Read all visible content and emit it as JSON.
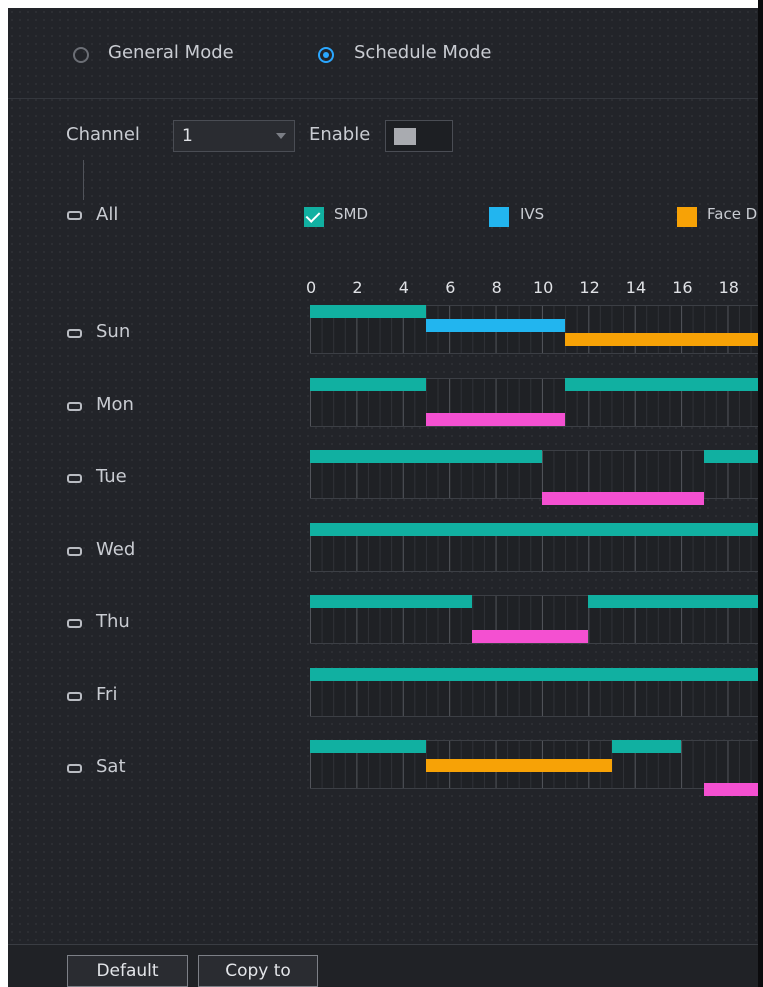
{
  "modes": {
    "general": "General Mode",
    "schedule": "Schedule Mode",
    "selected": "schedule"
  },
  "channel": {
    "label": "Channel",
    "value": "1"
  },
  "enable": {
    "label": "Enable",
    "on": false
  },
  "all_label": "All",
  "legend": [
    {
      "label": "SMD",
      "color": "#11b0a1",
      "checked": true
    },
    {
      "label": "IVS",
      "color": "#22b5ef",
      "checked": false
    },
    {
      "label": "Face D",
      "color": "#f7a206",
      "checked": false
    }
  ],
  "hour_ticks": [
    "0",
    "2",
    "4",
    "6",
    "8",
    "10",
    "12",
    "14",
    "16",
    "18"
  ],
  "days": [
    {
      "label": "Sun",
      "periods": [
        {
          "type": "SMD",
          "start": 0,
          "end": 5
        },
        {
          "type": "IVS",
          "start": 5,
          "end": 11
        },
        {
          "type": "Face",
          "start": 11,
          "end": 19.4
        }
      ]
    },
    {
      "label": "Mon",
      "periods": [
        {
          "type": "SMD",
          "start": 0,
          "end": 5
        },
        {
          "type": "SMD",
          "start": 11,
          "end": 19.4
        },
        {
          "type": "Other",
          "start": 5,
          "end": 11
        }
      ]
    },
    {
      "label": "Tue",
      "periods": [
        {
          "type": "SMD",
          "start": 0,
          "end": 10
        },
        {
          "type": "SMD",
          "start": 17,
          "end": 19.4
        },
        {
          "type": "Other",
          "start": 10,
          "end": 17
        }
      ]
    },
    {
      "label": "Wed",
      "periods": [
        {
          "type": "SMD",
          "start": 0,
          "end": 19.4
        }
      ]
    },
    {
      "label": "Thu",
      "periods": [
        {
          "type": "SMD",
          "start": 0,
          "end": 7
        },
        {
          "type": "SMD",
          "start": 12,
          "end": 19.4
        },
        {
          "type": "Other",
          "start": 7,
          "end": 12
        }
      ]
    },
    {
      "label": "Fri",
      "periods": [
        {
          "type": "SMD",
          "start": 0,
          "end": 19.4
        }
      ]
    },
    {
      "label": "Sat",
      "periods": [
        {
          "type": "SMD",
          "start": 0,
          "end": 5
        },
        {
          "type": "SMD",
          "start": 13,
          "end": 16
        },
        {
          "type": "Face",
          "start": 5,
          "end": 13
        },
        {
          "type": "Other",
          "start": 17,
          "end": 19.4
        }
      ]
    }
  ],
  "type_colors": {
    "SMD": "#11b0a1",
    "IVS": "#22b5ef",
    "Face": "#f7a206",
    "Other": "#f450d1"
  },
  "buttons": {
    "default": "Default",
    "copy_to": "Copy to"
  }
}
